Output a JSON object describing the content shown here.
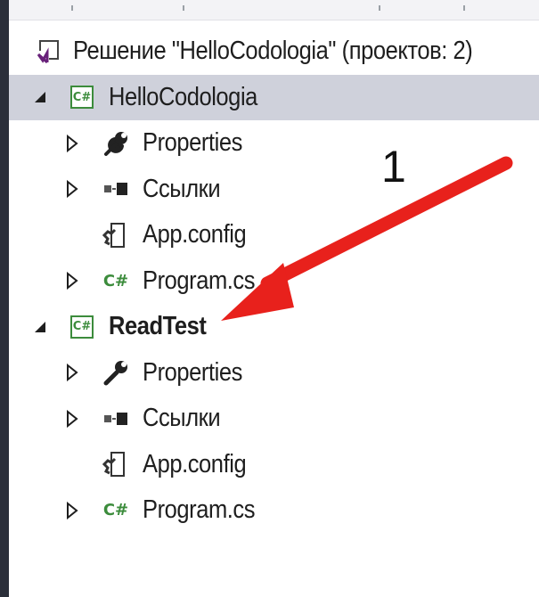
{
  "solution": {
    "label": "Решение \"HelloCodologia\" (проектов: 2)"
  },
  "projects": [
    {
      "name": "HelloCodologia",
      "icon_text": "C#",
      "items": [
        {
          "label": "Properties",
          "icon": "wrench-icon"
        },
        {
          "label": "Ссылки",
          "icon": "references-icon"
        },
        {
          "label": "App.config",
          "icon": "config-file-icon"
        },
        {
          "label": "Program.cs",
          "icon": "csharp-file-icon",
          "icon_text": "C#"
        }
      ]
    },
    {
      "name": "ReadTest",
      "icon_text": "C#",
      "items": [
        {
          "label": "Properties",
          "icon": "wrench-icon"
        },
        {
          "label": "Ссылки",
          "icon": "references-icon"
        },
        {
          "label": "App.config",
          "icon": "config-file-icon"
        },
        {
          "label": "Program.cs",
          "icon": "csharp-file-icon",
          "icon_text": "C#"
        }
      ]
    }
  ],
  "annotation": {
    "number": "1"
  },
  "colors": {
    "selection": "#cfd1db",
    "csharp_green": "#3c8c3c",
    "arrow_red": "#e8211c",
    "vs_purple": "#68217a"
  }
}
